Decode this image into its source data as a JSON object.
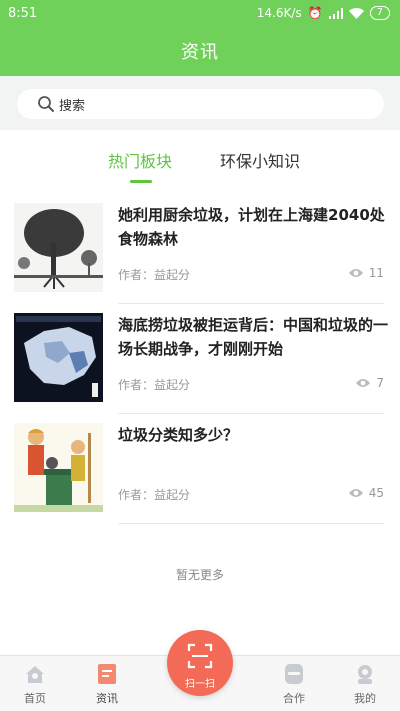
{
  "status": {
    "time": "8:51",
    "speed": "14.6K/s",
    "battery": "7"
  },
  "header": {
    "title": "资讯"
  },
  "search": {
    "placeholder": "搜索"
  },
  "tabs": [
    {
      "label": "热门板块",
      "active": true
    },
    {
      "label": "环保小知识",
      "active": false
    }
  ],
  "articles": [
    {
      "title": "她利用厨余垃圾，计划在上海建2040处食物森林",
      "author": "作者：益起分",
      "views": "11",
      "thumb_icon": "tree-illustration"
    },
    {
      "title": "海底捞垃圾被拒运背后：中国和垃圾的一场长期战争，才刚刚开始",
      "author": "作者：益起分",
      "views": "7",
      "thumb_icon": "china-map"
    },
    {
      "title": "垃圾分类知多少？",
      "author": "作者：益起分",
      "views": "45",
      "thumb_icon": "garbage-sorting-illustration"
    }
  ],
  "list_footer": "暂无更多",
  "nav": {
    "home": "首页",
    "news": "资讯",
    "scan": "扫一扫",
    "coop": "合作",
    "mine": "我的"
  },
  "colors": {
    "brand_green": "#6fd15a",
    "active_tab": "#5dc53e",
    "scan_orange": "#f36a56"
  }
}
